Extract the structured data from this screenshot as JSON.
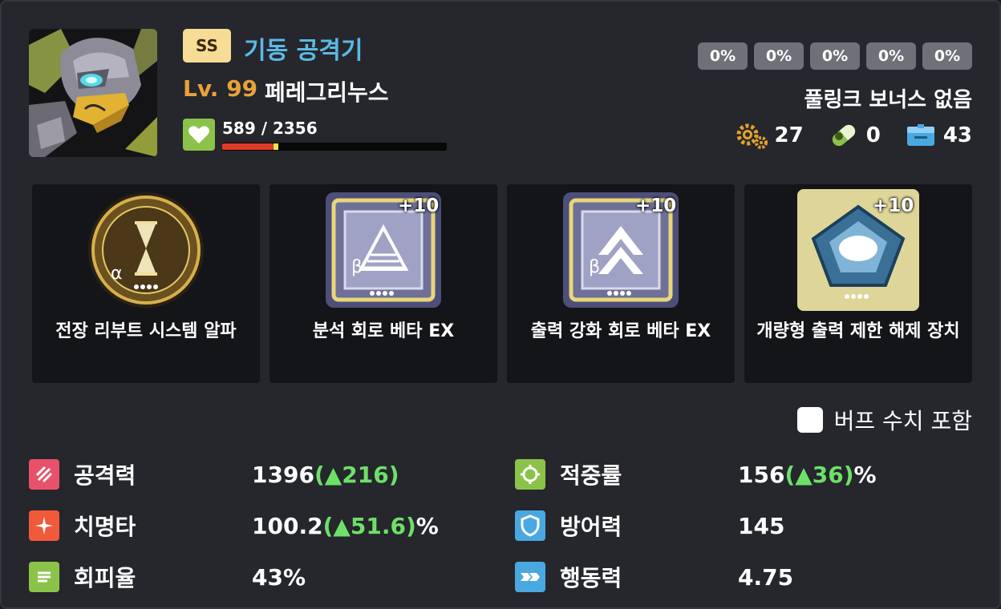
{
  "unit": {
    "grade": "SS",
    "class": "기동 공격기",
    "level": "Lv. 99",
    "name": "페레그리누스",
    "hp_text": "589 / 2356",
    "hp_fraction": 0.25
  },
  "links": [
    "0%",
    "0%",
    "0%",
    "0%",
    "0%"
  ],
  "fulllink": "풀링크 보너스 없음",
  "resources": [
    {
      "icon": "gears-icon",
      "value": "27"
    },
    {
      "icon": "capsule-icon",
      "value": "0"
    },
    {
      "icon": "box-icon",
      "value": "43"
    }
  ],
  "equipment": [
    {
      "name": "전장 리부트 시스템 알파",
      "plus": ""
    },
    {
      "name": "분석 회로 베타 EX",
      "plus": "+10"
    },
    {
      "name": "출력 강화 회로 베타 EX",
      "plus": "+10"
    },
    {
      "name": "개량형 출력 제한 해제 장치",
      "plus": "+10"
    }
  ],
  "buff_label": "버프 수치 포함",
  "stats": {
    "atk": {
      "label": "공격력",
      "base": "1396",
      "open": "(",
      "up": "▲216",
      "close": ")",
      "unit": ""
    },
    "acc": {
      "label": "적중률",
      "base": "156",
      "open": "(",
      "up": "▲36",
      "close": ")",
      "unit": "%"
    },
    "crit": {
      "label": "치명타",
      "base": "100.2",
      "open": "(",
      "up": "▲51.6",
      "close": ")",
      "unit": "%"
    },
    "def": {
      "label": "방어력",
      "base": "145"
    },
    "eva": {
      "label": "회피율",
      "base": "43%"
    },
    "spd": {
      "label": "행동력",
      "base": "4.75"
    }
  },
  "colors": {
    "atk": "#e8516a",
    "acc": "#8bc34a",
    "crit": "#f05a3a",
    "def": "#4aa8e0",
    "eva": "#8bc34a",
    "spd": "#4aa8e0",
    "up": "#6ee06a",
    "class": "#5db8e6",
    "level": "#e9a23b"
  }
}
